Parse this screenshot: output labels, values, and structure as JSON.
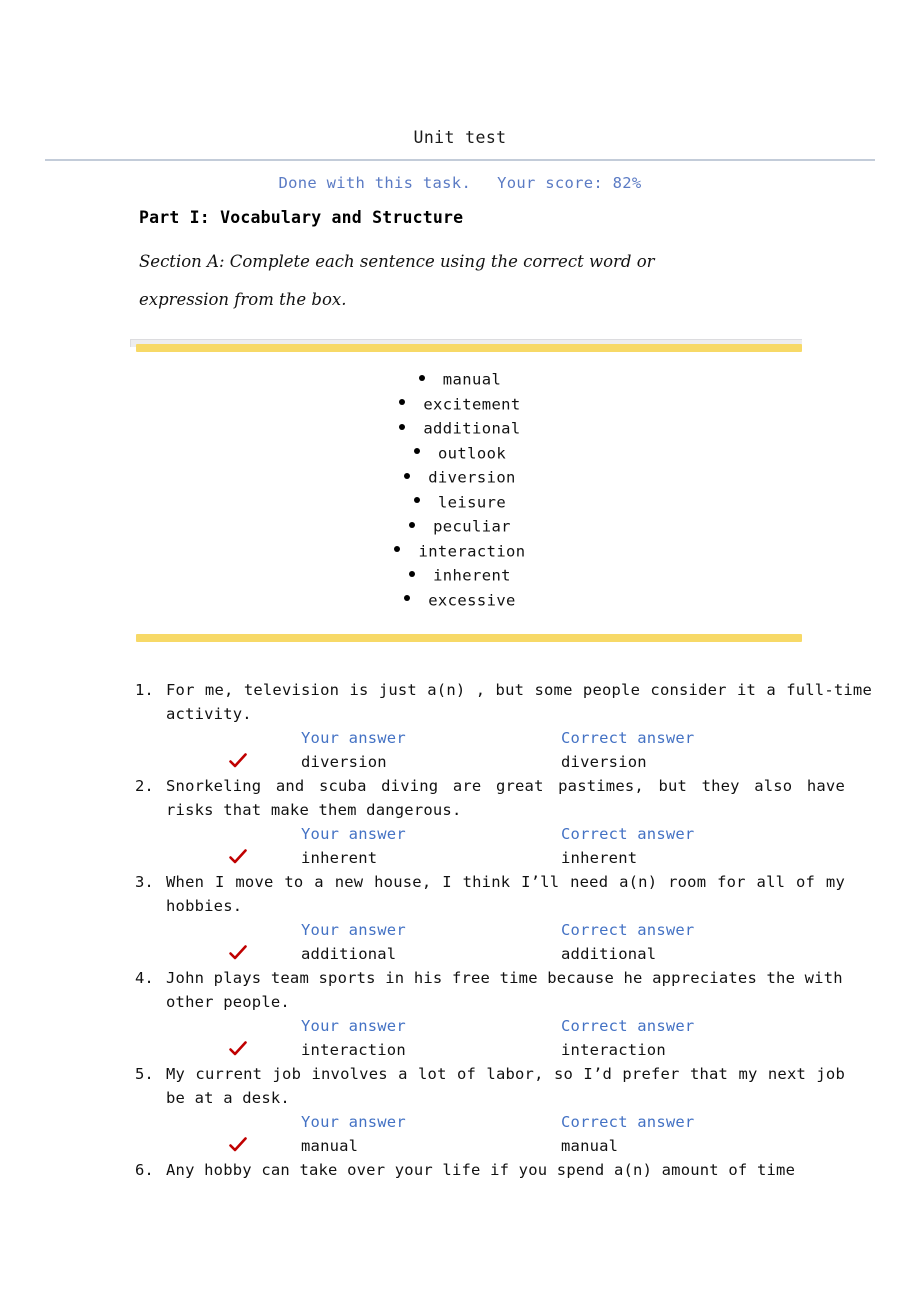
{
  "header": {
    "title": "Unit test",
    "status_done": "Done with this task.",
    "status_score": "Your score: 82%",
    "status_color": "#5b7bc4",
    "rule_color": "#c3ccd9"
  },
  "part": {
    "heading": "Part I: Vocabulary and Structure",
    "section_instruction_line1": "Section A: Complete each sentence using the correct word or",
    "section_instruction_line2": "expression from the box."
  },
  "wordbox": {
    "bar_color": "#f7d967",
    "words": [
      "manual",
      "excitement",
      "additional",
      "outlook",
      "diversion",
      "leisure",
      "peculiar",
      "interaction",
      "inherent",
      "excessive"
    ]
  },
  "answer_columns": {
    "your_answer": "Your answer",
    "correct_answer": "Correct answer",
    "header_color": "#4472c4",
    "check_color": "#c00000"
  },
  "questions": [
    {
      "number": "1.",
      "text": "For me, television is just a(n) , but some people consider it a full-time activity.",
      "your_answer": "diversion",
      "correct_answer": "diversion",
      "correct": true
    },
    {
      "number": "2.",
      "text": "Snorkeling and scuba diving are great pastimes, but they also have risks that make them dangerous.",
      "your_answer": "inherent",
      "correct_answer": "inherent",
      "correct": true
    },
    {
      "number": "3.",
      "text": "When I move to a new house, I think I’ll need a(n) room for all of my hobbies.",
      "your_answer": "additional",
      "correct_answer": "additional",
      "correct": true
    },
    {
      "number": "4.",
      "text": "John plays team sports in his free time because he appreciates the with other people.",
      "your_answer": "interaction",
      "correct_answer": "interaction",
      "correct": true
    },
    {
      "number": "5.",
      "text": "My current job involves a lot of labor, so I’d prefer that my next job be at a desk.",
      "your_answer": "manual",
      "correct_answer": "manual",
      "correct": true
    },
    {
      "number": "6.",
      "text": "Any hobby can take over your life if you spend a(n) amount of time",
      "your_answer": "",
      "correct_answer": "",
      "correct": false,
      "truncated": true
    }
  ]
}
